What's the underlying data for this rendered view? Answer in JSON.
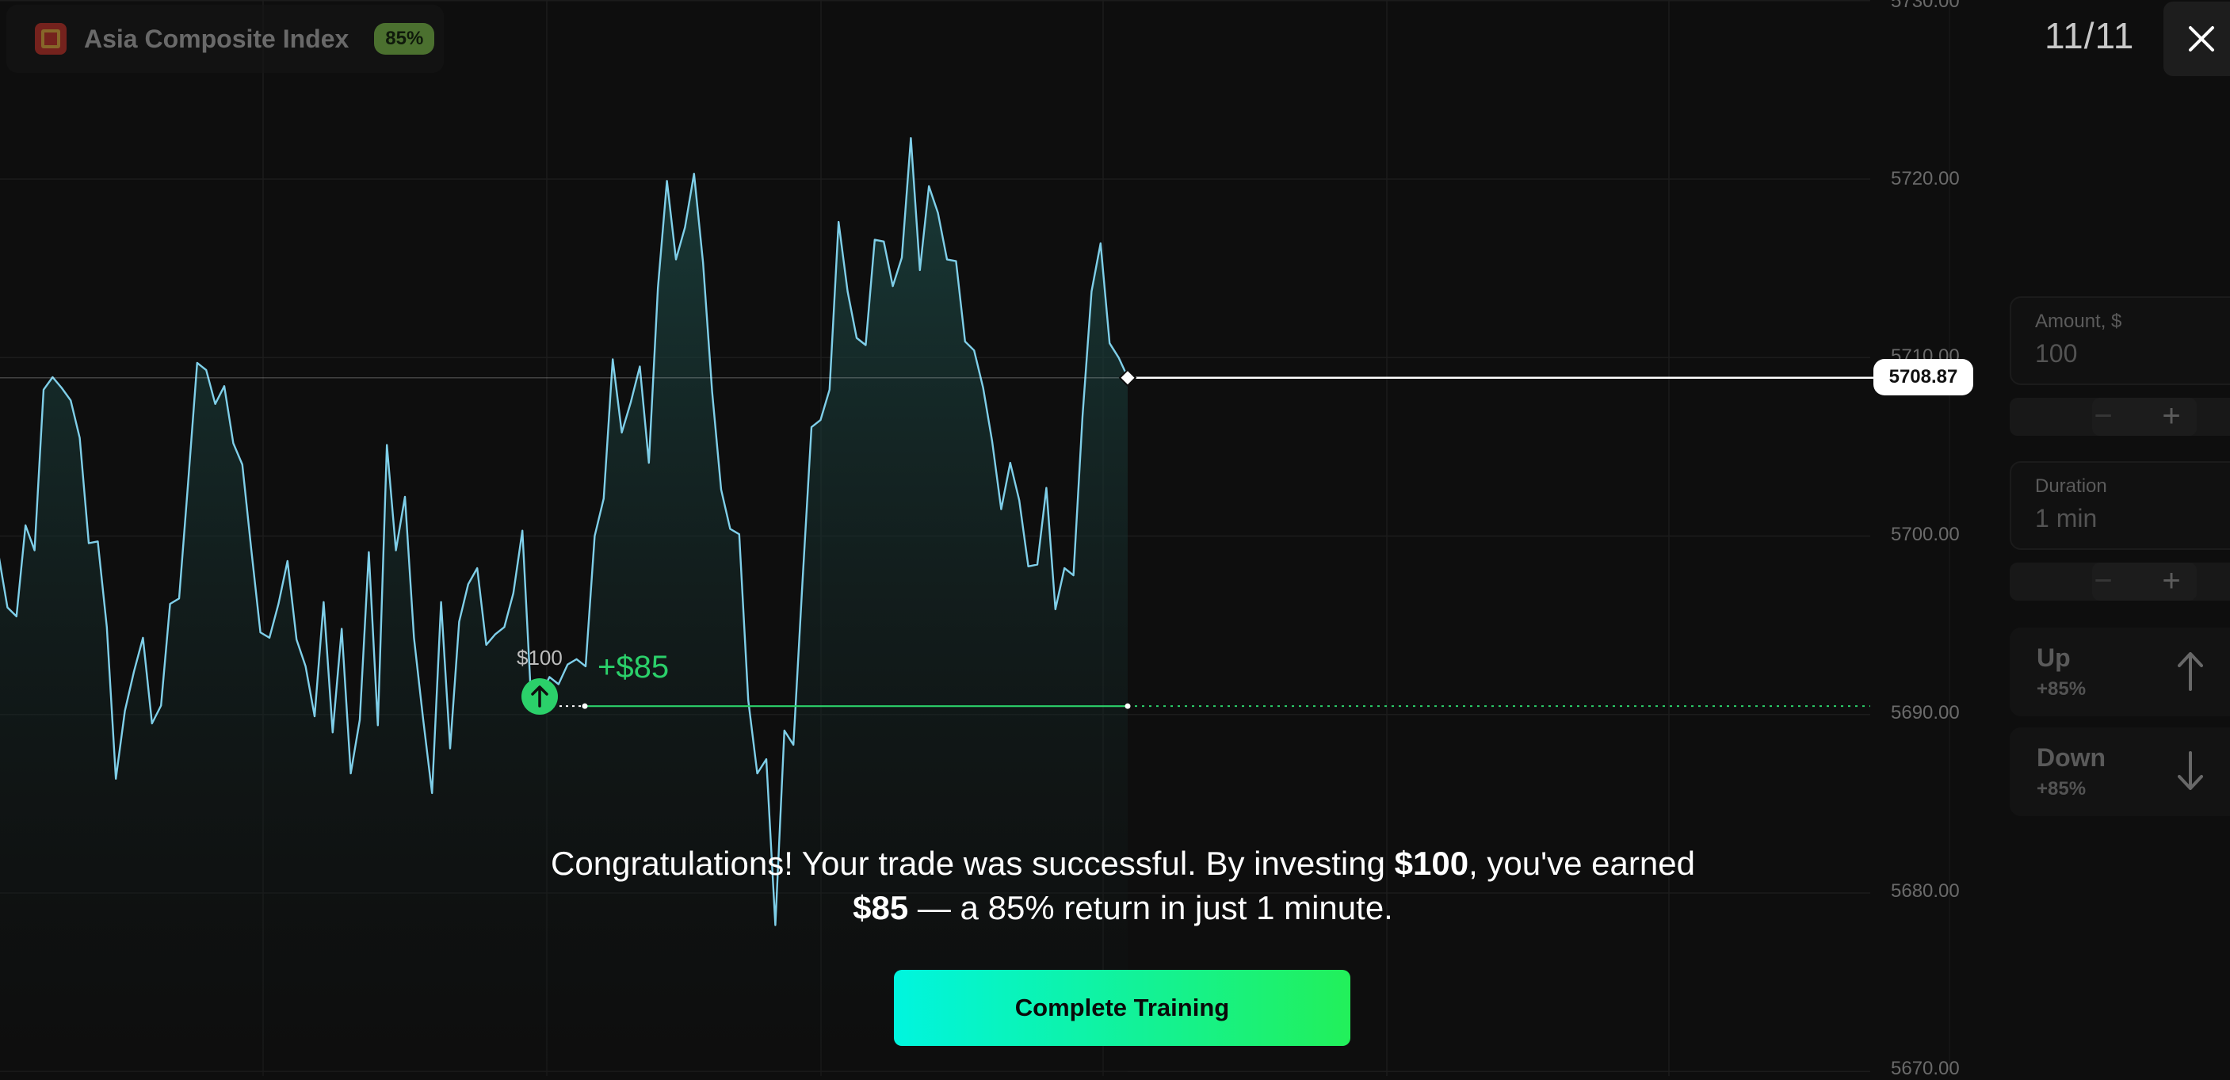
{
  "asset": {
    "name": "Asia Composite Index",
    "payout_badge": "85%",
    "flag_icon": "asia-flag-icon"
  },
  "progress": {
    "step": "11/11"
  },
  "chart_data": {
    "type": "line",
    "y_ticks": [
      "5730.00",
      "5720.00",
      "5710.00",
      "5700.00",
      "5690.00",
      "5680.00",
      "5670.00"
    ],
    "y_tick_values": [
      5730,
      5720,
      5710,
      5700,
      5690,
      5680,
      5670
    ],
    "current_price": "5708.87",
    "current_price_value": 5708.87,
    "entry_price": 5690.47,
    "values": [
      5699,
      5696,
      5695.5,
      5700.6,
      5699.2,
      5708.2,
      5708.9,
      5708.3,
      5707.6,
      5705.5,
      5699.6,
      5699.7,
      5694.9,
      5686.4,
      5690.2,
      5692.4,
      5694.3,
      5689.5,
      5690.5,
      5696.2,
      5696.5,
      5703,
      5709.7,
      5709.3,
      5707.4,
      5708.4,
      5705.2,
      5704,
      5699.2,
      5694.6,
      5694.3,
      5696.2,
      5698.6,
      5694.2,
      5692.7,
      5689.9,
      5696.3,
      5689,
      5694.8,
      5686.7,
      5689.7,
      5699.1,
      5689.4,
      5705.1,
      5699.2,
      5702.2,
      5694.3,
      5689.8,
      5685.6,
      5696.3,
      5688.1,
      5695.2,
      5697.3,
      5698.2,
      5693.9,
      5694.5,
      5694.9,
      5696.8,
      5700.3,
      5690.5,
      5691.1,
      5692.1,
      5691.7,
      5692.8,
      5693.1,
      5692.7,
      5700,
      5702.1,
      5709.9,
      5705.8,
      5707.5,
      5709.5,
      5704.1,
      5713.9,
      5719.9,
      5715.5,
      5717.3,
      5720.3,
      5715.3,
      5708.1,
      5702.6,
      5700.4,
      5700.1,
      5690.8,
      5686.7,
      5687.5,
      5678.2,
      5689.1,
      5688.3,
      5697.4,
      5706.1,
      5706.5,
      5708.2,
      5717.6,
      5713.7,
      5711.1,
      5710.7,
      5716.6,
      5716.5,
      5714,
      5715.6,
      5722.3,
      5714.9,
      5719.6,
      5718.1,
      5715.5,
      5715.4,
      5710.9,
      5710.4,
      5708.3,
      5705.3,
      5701.5,
      5704.1,
      5702,
      5698.3,
      5698.4,
      5702.7,
      5695.9,
      5698.2,
      5697.8,
      5706.7,
      5713.7,
      5716.4,
      5710.8,
      5710,
      5708.9
    ],
    "trade": {
      "amount": "$100",
      "profit": "+$85",
      "direction": "up"
    }
  },
  "form": {
    "amount_label": "Amount, $",
    "amount_value": "100",
    "duration_label": "Duration",
    "duration_value": "1 min",
    "minus": "−",
    "plus": "+"
  },
  "actions": {
    "up_label": "Up",
    "up_payout": "+85%",
    "down_label": "Down",
    "down_payout": "+85%"
  },
  "message": {
    "part1": "Congratulations! Your trade was successful. By investing ",
    "amount": "$100",
    "part2": ", you've earned ",
    "profit": "$85",
    "part3": " — a 85% return in just 1 minute."
  },
  "cta": {
    "label": "Complete Training"
  },
  "colors": {
    "line": "#7fcfe9",
    "win": "#2bd06a",
    "cta_start": "#00f5df",
    "cta_end": "#22f05a"
  }
}
